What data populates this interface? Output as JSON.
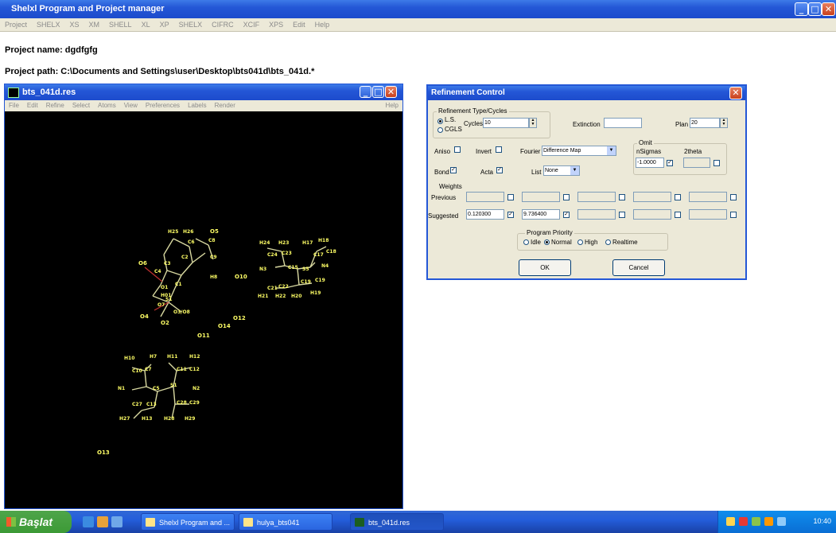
{
  "app": {
    "title": "Shelxl Program and Project manager",
    "menu": [
      "Project",
      "SHELX",
      "XS",
      "XM",
      "SHELL",
      "XL",
      "XP",
      "SHELX",
      "CIFRC",
      "XCIF",
      "XPS",
      "Edit",
      "Help"
    ]
  },
  "project": {
    "name_line": "Project name: dgdfgfg",
    "path_line": "Project path: C:\\Documents and Settings\\user\\Desktop\\bts041d\\bts_041d.*"
  },
  "plot_window": {
    "title": "bts_041d.res",
    "menu": [
      "File",
      "Edit",
      "Refine",
      "Select",
      "Atoms",
      "View",
      "Preferences",
      "Labels",
      "Render"
    ],
    "help": "Help",
    "labels": {
      "o13": "O13",
      "o10": "O10",
      "o11": "O11",
      "o12": "O12",
      "o14": "O14",
      "o4": "O4",
      "o6": "O6",
      "o5": "O5",
      "o2": "O2"
    }
  },
  "dialog": {
    "title": "Refinement Control",
    "refinement_group": "Refinement Type/Cycles",
    "ls_label": "L.S.",
    "cgls_label": "CGLS",
    "cycles_label": "Cycles",
    "cycles_value": "10",
    "extinction_label": "Extinction",
    "extinction_value": "",
    "plan_label": "Plan",
    "plan_value": "20",
    "omit_group": "Omit",
    "nsigmas_label": "nSigmas",
    "twotheta_label": "2theta",
    "omit_value": "-1.0000",
    "aniso_label": "Aniso",
    "invert_label": "Invert",
    "fourier_label": "Fourier",
    "fourier_value": "Difference Map",
    "bond_label": "Bond",
    "acta_label": "Acta",
    "list_label": "List",
    "list_value": "None",
    "weights_label": "Weights",
    "previous_label": "Previous",
    "suggested_label": "Suggested",
    "suggested_a": "0.120300",
    "suggested_b": "9.736400",
    "priority_group": "Program Priority",
    "priority_idle": "Idle",
    "priority_normal": "Normal",
    "priority_high": "High",
    "priority_realtime": "Realtime",
    "ok_label": "OK",
    "cancel_label": "Cancel"
  },
  "taskbar": {
    "start_label": "Başlat",
    "tasks": [
      "Shelxl Program and ...",
      "hulya_bts041",
      "bts_041d.res"
    ],
    "clock": "10:40"
  }
}
